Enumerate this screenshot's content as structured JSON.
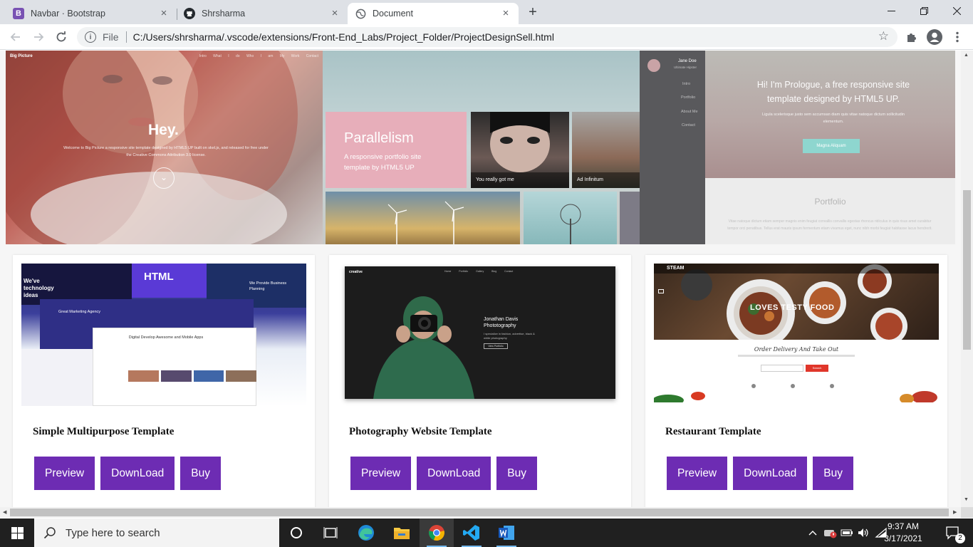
{
  "browser": {
    "tabs": [
      {
        "title": "Navbar · Bootstrap",
        "favicon": "B",
        "favicon_color": "#7952b3",
        "active": false
      },
      {
        "title": "Shrsharma",
        "favicon": "github-icon",
        "active": false
      },
      {
        "title": "Document",
        "favicon": "globe-icon",
        "active": true
      }
    ],
    "new_tab_symbol": "+",
    "address": {
      "scheme_label": "File",
      "url": "C:/Users/shrsharma/.vscode/extensions/Front-End_Labs/Project_Folder/ProjectDesignSell.html"
    }
  },
  "banner": {
    "big_picture": {
      "brand": "Big Picture",
      "nav": "Intro What I do Who I am My Work Contact",
      "heading": "Hey.",
      "text": "Welcome to Big Picture a responsive site template designed by HTML5 UP built on skel.js, and released for free under the Creative Commons Attribution 3.0 license."
    },
    "parallelism": {
      "title": "Parallelism",
      "subtitle": "A responsive portfolio site template by HTML5 UP",
      "tile1_caption": "You really got me",
      "tile2_caption": "Ad Infinitum"
    },
    "prologue": {
      "name": "Jane Doe",
      "role": "Ultimate Hipster",
      "nav": [
        "Intro",
        "Portfolio",
        "About Me",
        "Contact"
      ],
      "hero_title": "Hi! I'm Prologue, a free responsive site template designed by HTML5 UP.",
      "hero_text": "Ligula scelerisque justo sem accumsan diam quis vitae natoque dictum sollicitudin elementum.",
      "hero_button": "Magna Aliquam",
      "section_title": "Portfolio",
      "section_text": "Vitae natoque dictum etiam semper magnis enim feugiat convallis convallis egestas rhoncus ridiculus in quis risus amet curabitur tempor orci penatibus. Tellus erat mauris ipsum fermentum etiam vivamus eget, nunc nibh morbi feugiat habitasse lacus hendrerit."
    }
  },
  "cards": [
    {
      "title": "Simple Multipurpose Template",
      "thumb": {
        "headline": "HTML",
        "tag": "We've technology ideas",
        "tag2": "We Provide Business Planning",
        "tag3": "Great Marketing Agency",
        "tag4": "Digital Develop Awesome and Mobile Apps"
      },
      "buttons": [
        "Preview",
        "DownLoad",
        "Buy"
      ]
    },
    {
      "title": "Photography Website Template",
      "thumb": {
        "brand": "creative",
        "nav": "Home Portfolio Gallery Blog Contact",
        "headline": "Jonathan Davis Phototography",
        "text": "I specialize in fashion, advertise, black & white photography",
        "button": "View Portfolio"
      },
      "buttons": [
        "Preview",
        "DownLoad",
        "Buy"
      ]
    },
    {
      "title": "Restaurant Template",
      "thumb": {
        "brand": "STEAM",
        "headline": "LOVES TESTY FOOD",
        "script": "Order Delivery And Take Out",
        "search_btn": "Search"
      },
      "buttons": [
        "Preview",
        "DownLoad",
        "Buy"
      ]
    }
  ],
  "taskbar": {
    "search_placeholder": "Type here to search",
    "time": "9:37 AM",
    "date": "3/17/2021",
    "notification_count": "2",
    "accent": "#76b9ed"
  },
  "colors": {
    "button_purple": "#6d2cb3",
    "chrome_tabstrip": "#dee1e6"
  }
}
